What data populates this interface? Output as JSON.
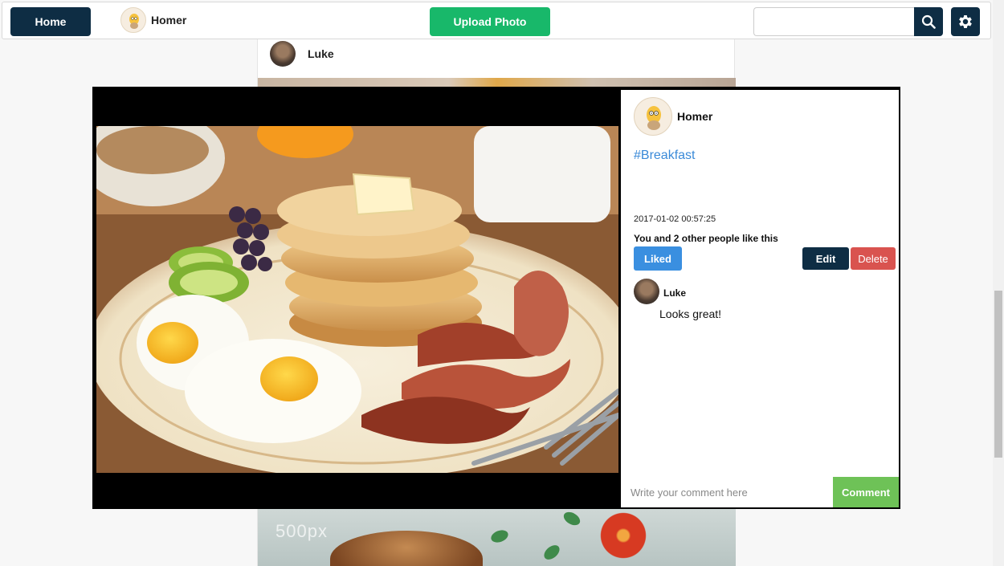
{
  "navbar": {
    "home_label": "Home",
    "user_name": "Homer",
    "upload_label": "Upload Photo",
    "search_placeholder": "",
    "search_icon": "search-icon",
    "settings_icon": "gear-icon"
  },
  "feed": {
    "post_user": "Luke",
    "watermark": "500px"
  },
  "modal": {
    "user_name": "Homer",
    "tag": "#Breakfast",
    "timestamp": "2017-01-02 00:57:25",
    "like_text": "You and 2 other people like this",
    "liked_label": "Liked",
    "edit_label": "Edit",
    "delete_label": "Delete",
    "comments": [
      {
        "user": "Luke",
        "text": "Looks great!"
      }
    ],
    "comment_placeholder": "Write your comment here",
    "comment_button": "Comment"
  },
  "colors": {
    "navy": "#0e2d44",
    "green": "#18b86a",
    "blue": "#3a8fe0",
    "red": "#d9534f",
    "comment_green": "#6ec257"
  }
}
